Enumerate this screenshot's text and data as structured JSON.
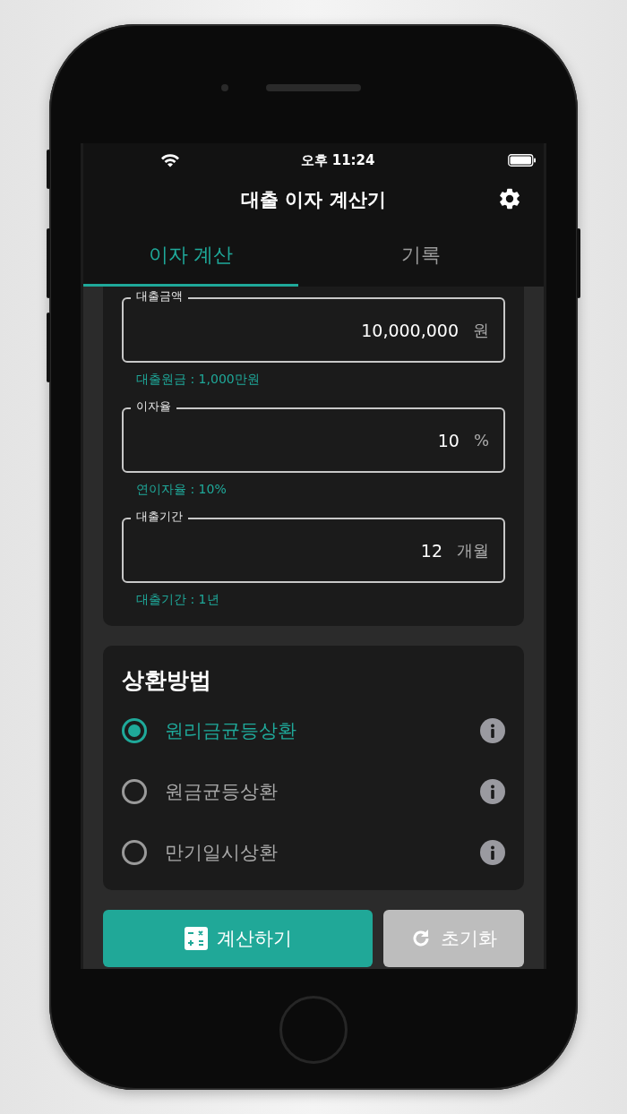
{
  "status_bar": {
    "time": "오후 11:24"
  },
  "header": {
    "title": "대출 이자 계산기"
  },
  "tabs": [
    {
      "label": "이자 계산",
      "selected": true
    },
    {
      "label": "기록",
      "selected": false
    }
  ],
  "fields": [
    {
      "label": "대출금액",
      "value": "10,000,000",
      "unit": "원",
      "helper": "대출원금 : 1,000만원"
    },
    {
      "label": "이자율",
      "value": "10",
      "unit": "%",
      "helper": "연이자율 : 10%"
    },
    {
      "label": "대출기간",
      "value": "12",
      "unit": "개월",
      "helper": "대출기간 : 1년"
    }
  ],
  "repayment": {
    "title": "상환방법",
    "options": [
      {
        "label": "원리금균등상환",
        "selected": true
      },
      {
        "label": "원금균등상환",
        "selected": false
      },
      {
        "label": "만기일시상환",
        "selected": false
      }
    ]
  },
  "buttons": [
    {
      "kind": "calculate",
      "label": "계산하기"
    },
    {
      "kind": "reset",
      "label": "초기화"
    }
  ]
}
